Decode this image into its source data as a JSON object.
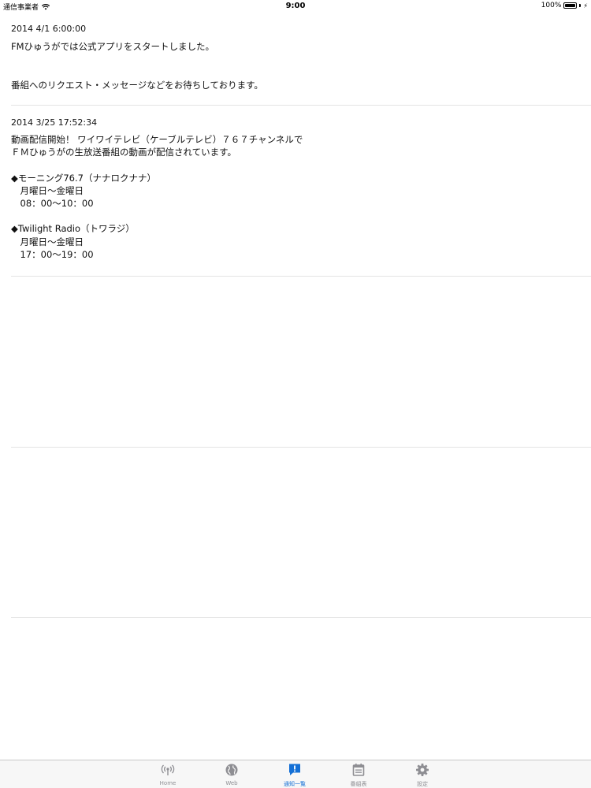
{
  "status_bar": {
    "carrier": "通信事業者",
    "time": "9:00",
    "battery": "100%"
  },
  "news": [
    {
      "date": "2014 4/1 6:00:00",
      "body": "FMひゅうがでは公式アプリをスタートしました。\n\n\n番組へのリクエスト・メッセージなどをお待ちしております。"
    },
    {
      "date": "2014 3/25 17:52:34",
      "body": "動画配信開始！ ワイワイテレビ（ケーブルテレビ）７６７チャンネルで\nＦＭひゅうがの生放送番組の動画が配信されています。\n\n◆モーニング76.7（ナナロクナナ）\n　月曜日～金曜日\n　08：00～10：00\n\n◆Twilight Radio（トワラジ）\n　月曜日～金曜日\n　17：00～19：00"
    }
  ],
  "tabs": [
    {
      "label": "Home",
      "icon": "radio-broadcast-icon"
    },
    {
      "label": "Web",
      "icon": "globe-icon"
    },
    {
      "label": "通知一覧",
      "icon": "notification-icon"
    },
    {
      "label": "番組表",
      "icon": "schedule-icon"
    },
    {
      "label": "設定",
      "icon": "gear-icon"
    }
  ],
  "colors": {
    "accent": "#1470d6",
    "tab_inactive": "#8e8e93",
    "divider": "#e3e3e3"
  }
}
